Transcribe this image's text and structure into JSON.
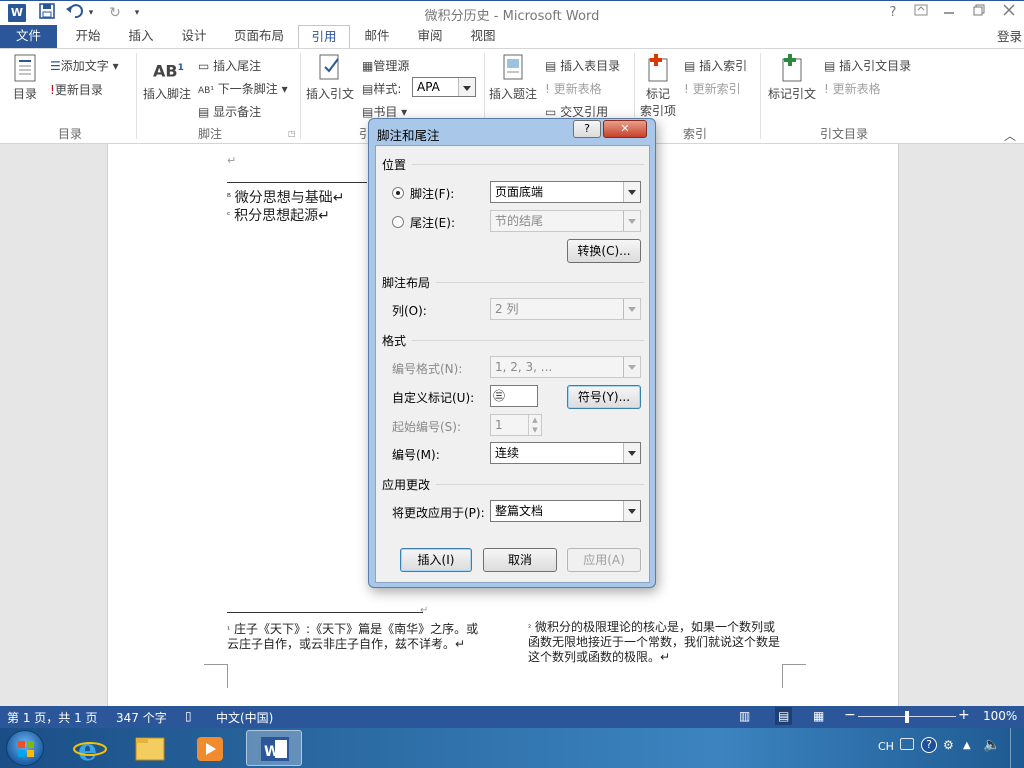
{
  "app": {
    "window_title": "微积分历史 - Microsoft Word",
    "login": "登录"
  },
  "qat": {
    "word_icon": "W",
    "undo_arrow": "▾",
    "redo_icon": "↻",
    "customize": "▾"
  },
  "tabs": [
    {
      "label": "文件"
    },
    {
      "label": "开始"
    },
    {
      "label": "插入"
    },
    {
      "label": "设计"
    },
    {
      "label": "页面布局"
    },
    {
      "label": "引用"
    },
    {
      "label": "邮件"
    },
    {
      "label": "审阅"
    },
    {
      "label": "视图"
    }
  ],
  "ribbon": {
    "toc": {
      "big": "目录",
      "add_text": "添加文字",
      "update": "更新目录",
      "group": "目录"
    },
    "footnotes": {
      "big": "插入脚注",
      "insert_endnote": "插入尾注",
      "next_footnote": "下一条脚注",
      "show_notes": "显示备注",
      "group": "脚注"
    },
    "citations": {
      "big": "插入引文",
      "manage": "管理源",
      "style_label": "样式:",
      "style_value": "APA",
      "bibliography": "书目",
      "group": "引"
    },
    "captions": {
      "big": "插入题注",
      "insert_toc_fig": "插入表目录",
      "update_table": "更新表格",
      "cross_ref": "交叉引用"
    },
    "index": {
      "big_line1": "标记",
      "big_line2": "索引项",
      "insert_index": "插入索引",
      "update_index": "更新索引",
      "group": "索引"
    },
    "toa": {
      "big": "标记引文",
      "insert_toa": "插入引文目录",
      "update_table": "更新表格",
      "group": "引文目录"
    }
  },
  "document": {
    "top_notes": [
      {
        "mark": "ᴮ",
        "text": "微分思想与基础↵"
      },
      {
        "mark": "ᶜ",
        "text": "积分思想起源↵"
      }
    ],
    "bottom_left_note": {
      "mark": "¹",
      "text": "庄子《天下》:《天下》篇是《南华》之序。或云庄子自作，或云非庄子自作，兹不详考。↵"
    },
    "bottom_right_note": {
      "mark": "²",
      "text": "微积分的极限理论的核心是，如果一个数列或函数无限地接近于一个常数，我们就说这个数是这个数列或函数的极限。↵"
    }
  },
  "dialog": {
    "title": "脚注和尾注",
    "help": "?",
    "close": "✕",
    "location_section": "位置",
    "footnote_label": "脚注(F):",
    "footnote_value": "页面底端",
    "endnote_label": "尾注(E):",
    "endnote_value": "节的结尾",
    "convert_button": "转换(C)...",
    "layout_section": "脚注布局",
    "columns_label": "列(O):",
    "columns_value": "2 列",
    "format_section": "格式",
    "number_format_label": "编号格式(N):",
    "number_format_value": "1, 2, 3, ...",
    "custom_mark_label": "自定义标记(U):",
    "custom_mark_value": "㊂",
    "symbol_button": "符号(Y)...",
    "start_at_label": "起始编号(S):",
    "start_at_value": "1",
    "numbering_label": "编号(M):",
    "numbering_value": "连续",
    "apply_section": "应用更改",
    "apply_to_label": "将更改应用于(P):",
    "apply_to_value": "整篇文档",
    "insert_button": "插入(I)",
    "cancel_button": "取消",
    "apply_button": "应用(A)"
  },
  "status": {
    "page": "第 1 页，共 1 页",
    "words": "347 个字",
    "lang": "中文(中国)",
    "zoom": "100%",
    "zoom_level": 1.0
  },
  "taskbar": {
    "tray_lang": "CH"
  },
  "colors": {
    "accent": "#2b579a",
    "dialog_frame": "#a9c7e8"
  }
}
